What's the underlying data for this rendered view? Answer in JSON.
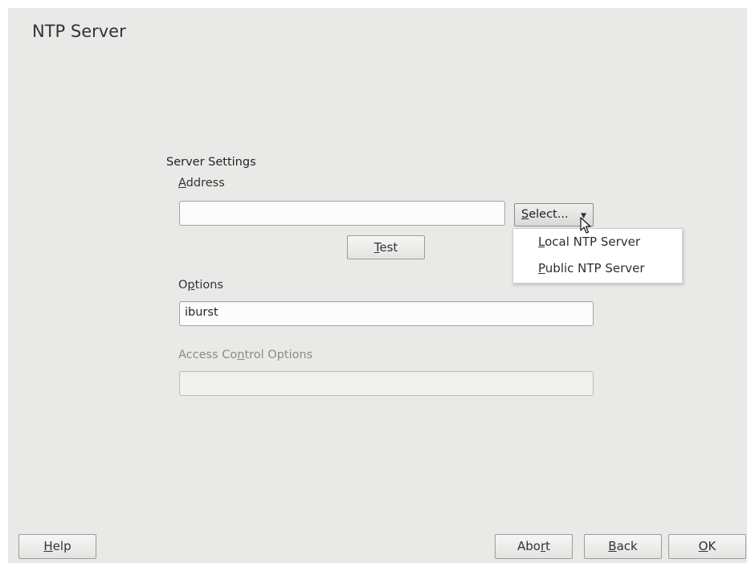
{
  "window": {
    "title": "NTP Server"
  },
  "server_settings": {
    "section_label": "Server Settings",
    "address": {
      "label_mnemonic": "A",
      "label_rest": "ddress",
      "value": ""
    },
    "select_button": {
      "label_mnemonic": "S",
      "label_rest": "elect...",
      "arrow_icon": "triangle-down-icon"
    },
    "select_menu": {
      "items": [
        {
          "mnemonic": "L",
          "rest": "ocal NTP Server"
        },
        {
          "mnemonic": "P",
          "rest": "ublic NTP Server"
        }
      ]
    },
    "test_button": {
      "label_mnemonic": "T",
      "label_rest": "est"
    },
    "options": {
      "label_pre": "O",
      "label_mnemonic": "p",
      "label_post": "tions",
      "value": "iburst"
    },
    "access_control": {
      "label_pre": "Access Co",
      "label_mnemonic": "n",
      "label_post": "trol Options",
      "value": "",
      "enabled": false
    }
  },
  "footer": {
    "help": {
      "mnemonic": "H",
      "rest": "elp"
    },
    "abort": {
      "pre": "Abo",
      "mnemonic": "r",
      "post": "t"
    },
    "back": {
      "mnemonic": "B",
      "rest": "ack"
    },
    "ok": {
      "mnemonic": "O",
      "rest": "K"
    }
  },
  "cursor_icon": "mouse-pointer-icon"
}
